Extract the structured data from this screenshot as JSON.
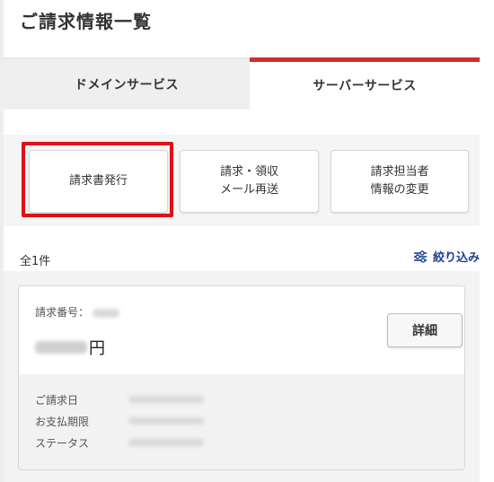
{
  "page": {
    "title": "ご請求情報一覧"
  },
  "tabs": [
    {
      "label": "ドメインサービス",
      "active": false
    },
    {
      "label": "サーバーサービス",
      "active": true
    }
  ],
  "actions": {
    "issue_invoice": "請求書発行",
    "resend_line1": "請求・領収",
    "resend_line2": "メール再送",
    "change_line1": "請求担当者",
    "change_line2": "情報の変更"
  },
  "list": {
    "count_text": "全1件",
    "filter_label": "絞り込み"
  },
  "invoice": {
    "number_label": "請求番号：",
    "currency": "円",
    "detail_button": "詳細",
    "fields": {
      "billing_date": "ご請求日",
      "due_date": "お支払期限",
      "status": "ステータス"
    }
  },
  "colors": {
    "active_tab_border": "#d42b2b",
    "highlight_box": "#e10f16",
    "filter_link": "#1c3f95"
  }
}
